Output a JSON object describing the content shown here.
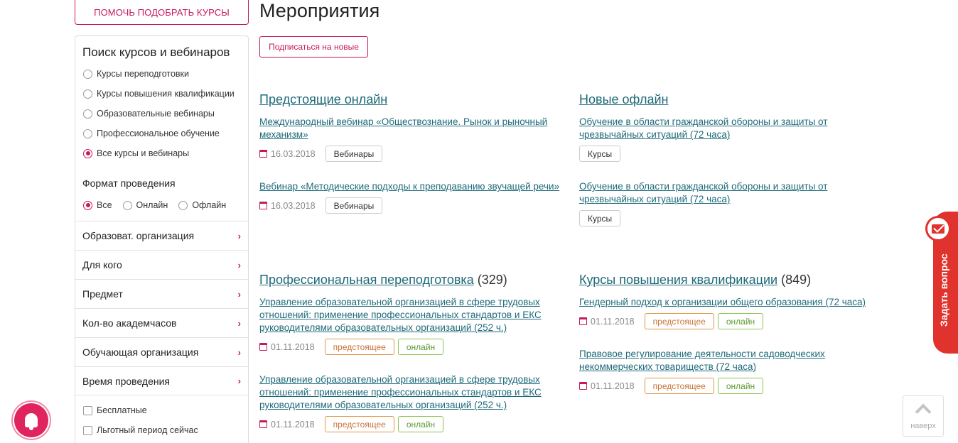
{
  "help_button": "ПОМОЧЬ ПОДОБРАТЬ КУРСЫ",
  "sidebar": {
    "title": "Поиск курсов и вебинаров",
    "types": [
      {
        "label": "Курсы переподготовки",
        "selected": false
      },
      {
        "label": "Курсы повышения квалификации",
        "selected": false
      },
      {
        "label": "Образовательные вебинары",
        "selected": false
      },
      {
        "label": "Профессиональное обучение",
        "selected": false
      },
      {
        "label": "Все курсы и вебинары",
        "selected": true
      }
    ],
    "format_title": "Формат проведения",
    "formats": [
      {
        "label": "Все",
        "selected": true
      },
      {
        "label": "Онлайн",
        "selected": false
      },
      {
        "label": "Офлайн",
        "selected": false
      }
    ],
    "filters": [
      "Образоват. организация",
      "Для кого",
      "Предмет",
      "Кол-во академчасов",
      "Обучающая организация",
      "Время проведения"
    ],
    "checks": [
      {
        "label": "Бесплатные",
        "checked": false
      },
      {
        "label": "Льготный период сейчас",
        "checked": false
      }
    ]
  },
  "main": {
    "title": "Мероприятия",
    "subscribe": "Подписаться на новые",
    "sections": [
      {
        "title": "Предстоящие онлайн",
        "count": "",
        "items": [
          {
            "title": "Международный вебинар «Обществознание. Рынок и рыночный механизм»",
            "date": "16.03.2018",
            "tags": [
              "Вебинары"
            ]
          },
          {
            "title": "Вебинар «Методические подходы к преподаванию звучащей речи»",
            "date": "16.03.2018",
            "tags": [
              "Вебинары"
            ]
          }
        ]
      },
      {
        "title": "Новые офлайн",
        "count": "",
        "items": [
          {
            "title": "Обучение в области гражданской обороны и защиты от чрезвычайных ситуаций (72 часа)",
            "date": "",
            "tags": [
              "Курсы"
            ]
          },
          {
            "title": "Обучение в области гражданской обороны и защиты от чрезвычайных ситуаций (72 часа)",
            "date": "",
            "tags": [
              "Курсы"
            ]
          }
        ]
      },
      {
        "title": "Профессиональная переподготовка",
        "count": "(329)",
        "items": [
          {
            "title": "Управление образовательной организацией в сфере трудовых отношений: применение профессиональных стандартов и ЕКС руководителями образовательных организаций (252 ч.)",
            "date": "01.11.2018",
            "tags": [
              "предстоящее",
              "онлайн"
            ]
          },
          {
            "title": "Управление образовательной организацией в сфере трудовых отношений: применение профессиональных стандартов и ЕКС руководителями образовательных организаций (252 ч.)",
            "date": "01.11.2018",
            "tags": [
              "предстоящее",
              "онлайн"
            ]
          }
        ]
      },
      {
        "title": "Курсы повышения квалификации",
        "count": "(849)",
        "items": [
          {
            "title": "Гендерный подход к организации общего образования (72 часа)",
            "date": "01.11.2018",
            "tags": [
              "предстоящее",
              "онлайн"
            ]
          },
          {
            "title": "Правовое регулирование деятельности садоводческих некоммерческих товариществ (72 часа)",
            "date": "01.11.2018",
            "tags": [
              "предстоящее",
              "онлайн"
            ]
          }
        ]
      }
    ]
  },
  "widgets": {
    "ask_question": "Задать вопрос",
    "to_top": "наверх"
  },
  "colors": {
    "accent": "#c8185c",
    "link": "#1e6a7a",
    "upcoming": "#e09848",
    "online": "#8cc44f",
    "ask_tab": "#e0332d"
  }
}
